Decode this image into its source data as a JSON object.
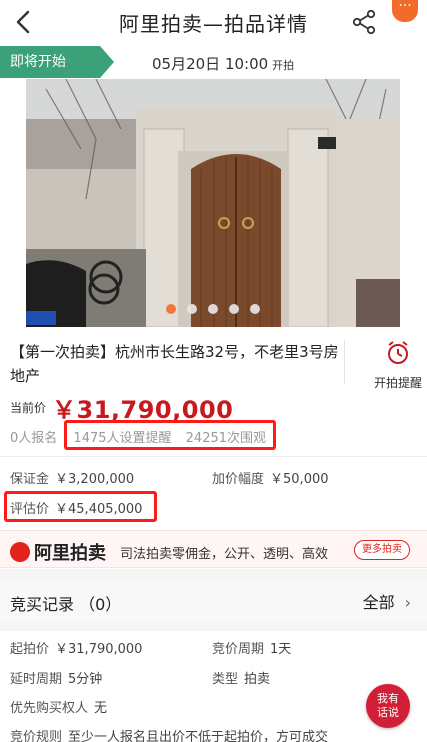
{
  "nav": {
    "title": "阿里拍卖—拍品详情",
    "more_icon": "more-dots-icon"
  },
  "status": {
    "tag": "即将开始",
    "time": "05月20日  10:00",
    "time_suffix": "开拍",
    "tag_color": "#3aa179"
  },
  "gallery": {
    "image_description": "house-gate-photo",
    "dot_count": 5,
    "active_dot": 0
  },
  "item": {
    "title": "【第一次拍卖】杭州市长生路32号，不老里3号房地产",
    "remind_label": "开拍提醒"
  },
  "price": {
    "label": "当前价",
    "value": "￥31,790,000",
    "color": "#c8191d"
  },
  "stats": {
    "signups": "0人报名",
    "reminders": "1475人设置提醒",
    "views": "24251次围观"
  },
  "deposit": {
    "label": "保证金",
    "value": "￥3,200,000"
  },
  "increment": {
    "label": "加价幅度",
    "value": "￥50,000"
  },
  "appraisal": {
    "label": "评估价",
    "value": "￥45,405,000"
  },
  "banner": {
    "logo_text": "阿里拍卖",
    "text": "司法拍卖零佣金，公开、透明、高效",
    "button": "更多拍卖"
  },
  "records": {
    "title": "竞买记录 （0）",
    "all_label": "全部"
  },
  "details": {
    "start_price_label": "起拍价",
    "start_price_value": "￥31,790,000",
    "cycle_label": "竞价周期",
    "cycle_value": "1天",
    "delay_label": "延时周期",
    "delay_value": "5分钟",
    "type_label": "类型",
    "type_value": "拍卖",
    "priority_label": "优先购买权人",
    "priority_value": "无",
    "rule_label": "竞价规则",
    "rule_value": "至少一人报名且出价不低于起拍价，方可成交"
  },
  "chat": {
    "label_line1": "我有",
    "label_line2": "话说"
  }
}
